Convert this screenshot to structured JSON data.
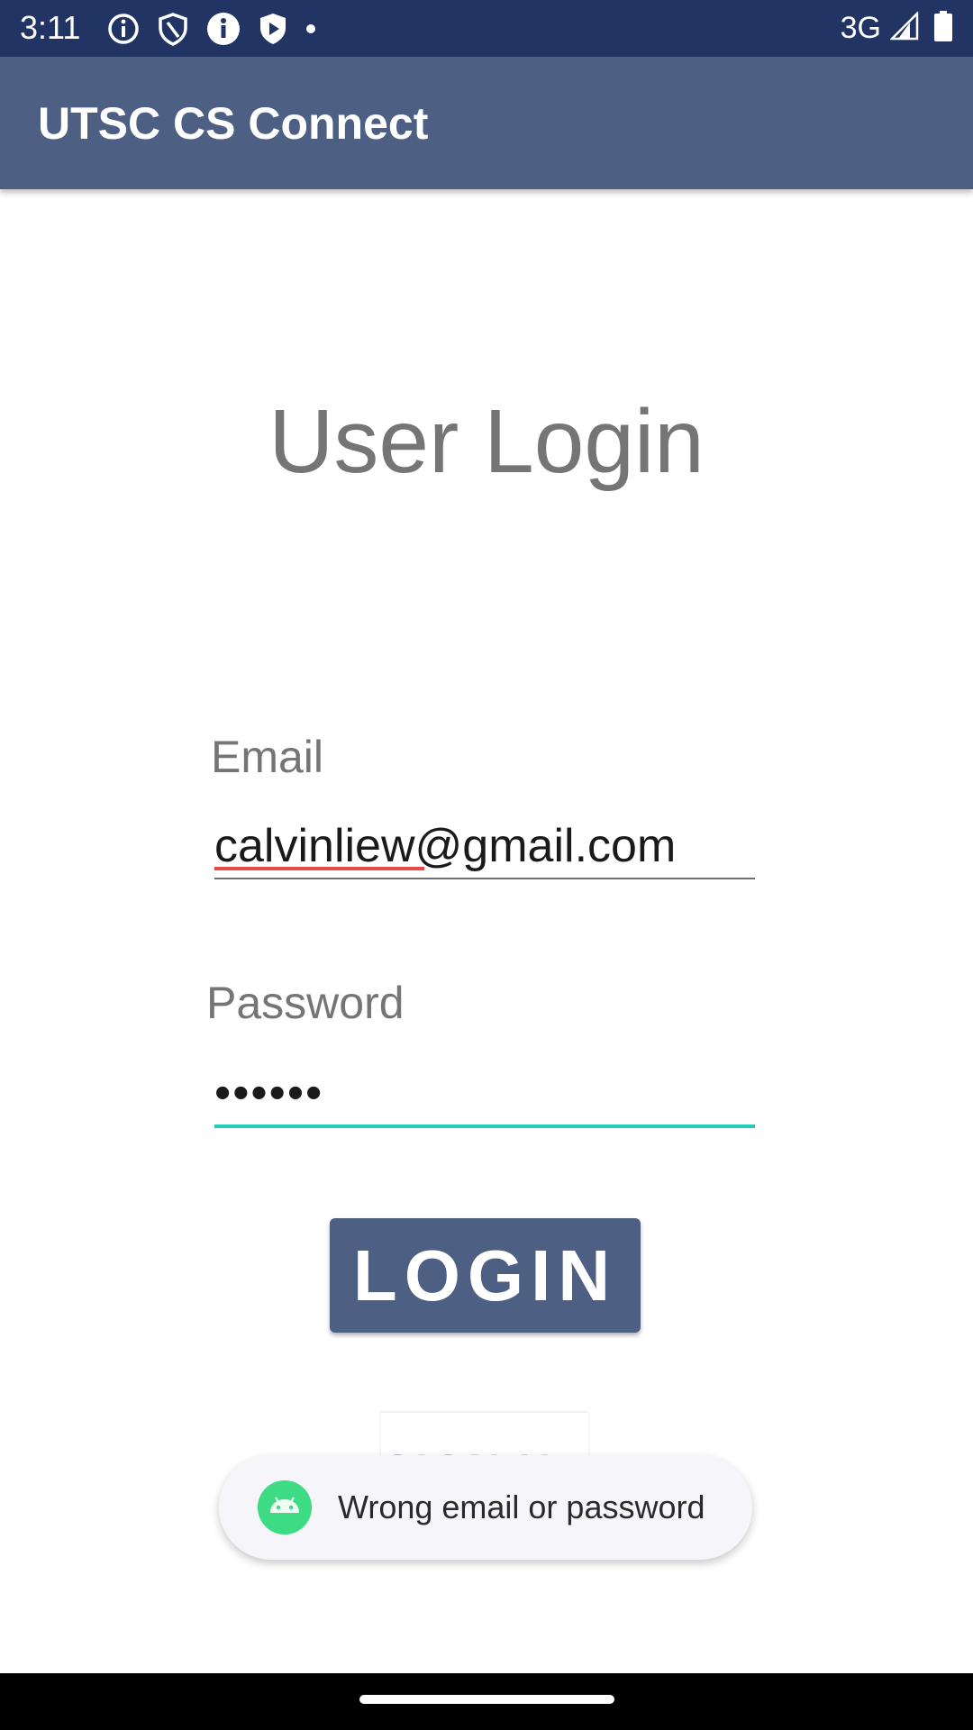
{
  "status_bar": {
    "time": "3:11",
    "network": "3G",
    "icons": [
      "info-outline-icon",
      "shield-icon",
      "info-filled-icon",
      "play-shield-icon",
      "dot-icon",
      "signal-icon",
      "battery-icon"
    ]
  },
  "app_bar": {
    "title": "UTSC CS Connect"
  },
  "login": {
    "heading": "User Login",
    "email_label": "Email",
    "email_value": "calvinliew@gmail.com",
    "password_label": "Password",
    "password_value": "••••••",
    "login_button": "LOGIN",
    "signup_button": "SIGN UP"
  },
  "toast": {
    "message": "Wrong email or password"
  },
  "colors": {
    "status_bar": "#213463",
    "app_bar": "#4e5f84",
    "accent": "#1fcfb8",
    "button": "#4e5f84",
    "toast_icon": "#3ddc84"
  }
}
